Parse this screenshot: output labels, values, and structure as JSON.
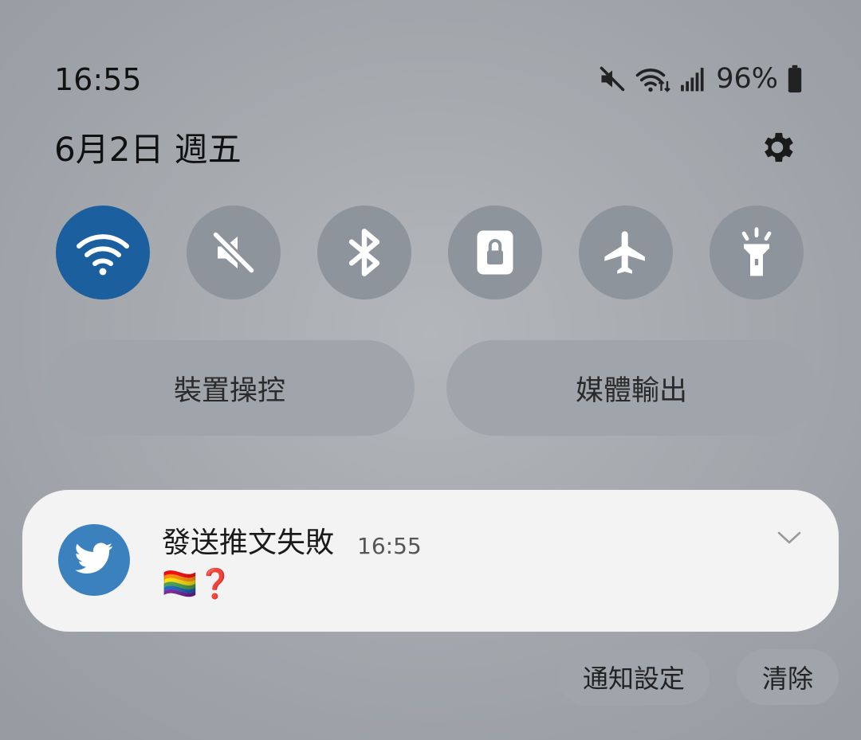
{
  "status_bar": {
    "time": "16:55",
    "battery_percent": "96%",
    "icons": [
      "mute-icon",
      "wifi-data-icon",
      "signal-icon",
      "battery-icon"
    ]
  },
  "header": {
    "date": "6月2日 週五",
    "settings_icon": "gear-icon"
  },
  "quick_toggles": [
    {
      "name": "wifi",
      "icon": "wifi-icon",
      "active": true
    },
    {
      "name": "sound",
      "icon": "mute-icon",
      "active": false
    },
    {
      "name": "bluetooth",
      "icon": "bluetooth-icon",
      "active": false
    },
    {
      "name": "screen-lock",
      "icon": "lock-icon",
      "active": false
    },
    {
      "name": "airplane",
      "icon": "airplane-icon",
      "active": false
    },
    {
      "name": "flashlight",
      "icon": "flashlight-icon",
      "active": false
    }
  ],
  "pills": {
    "device_control": "裝置操控",
    "media_output": "媒體輸出"
  },
  "notification": {
    "app_icon": "twitter-icon",
    "title": "發送推文失敗",
    "time": "16:55",
    "body": "🏳️‍🌈❓"
  },
  "actions": {
    "notification_settings": "通知設定",
    "clear": "清除"
  },
  "colors": {
    "active_toggle": "#1b5f9e",
    "inactive_toggle": "#8e949b",
    "twitter_blue": "#3b81bd",
    "card_bg": "#f3f3f4"
  }
}
